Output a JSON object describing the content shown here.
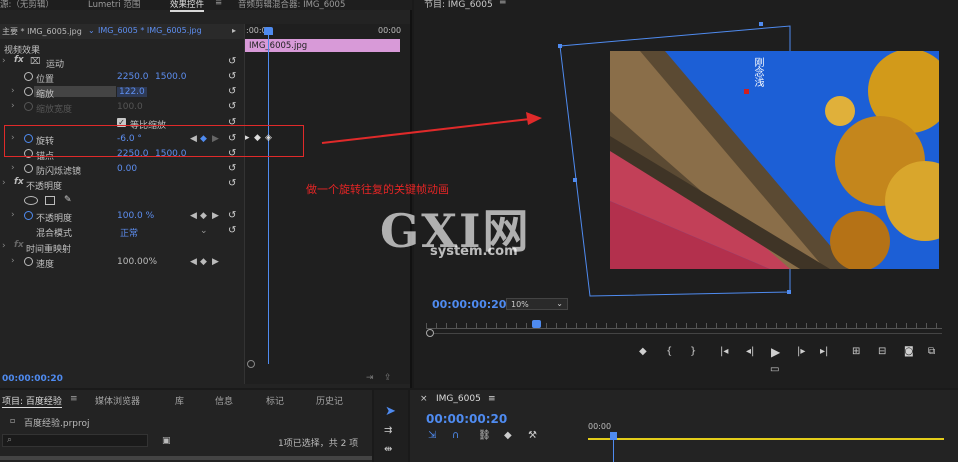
{
  "effect_controls": {
    "tabs": [
      "源:（无剪辑）",
      "Lumetri 范围",
      "效果控件",
      "≡",
      "音频剪辑混合器: IMG_6005"
    ],
    "master_label": "主要 * IMG_6005.jpg",
    "clip_label": "IMG_6005 * IMG_6005.jpg",
    "timeline_start": ":00:00",
    "timeline_end": "00:00",
    "clip_name": "IMG_6005.jpg",
    "section_video": "视频效果",
    "motion": "运动",
    "position_label": "位置",
    "position_x": "2250.0",
    "position_y": "1500.0",
    "scale_label": "缩放",
    "scale_value": "122.0",
    "scale_width_label": "缩放宽度",
    "scale_width_value": "100.0",
    "uniform_scale_label": "等比缩放",
    "rotation_label": "旋转",
    "rotation_value": "-6.0 °",
    "anchor_label": "锚点",
    "anchor_x": "2250.0",
    "anchor_y": "1500.0",
    "antiflicker_label": "防闪烁滤镜",
    "antiflicker_value": "0.00",
    "opacity_section": "不透明度",
    "opacity_label": "不透明度",
    "opacity_value": "100.0 %",
    "blend_label": "混合模式",
    "blend_value": "正常",
    "timeremap_section": "时间重映射",
    "speed_label": "速度",
    "speed_value": "100.00%",
    "timecode": "00:00:00:20"
  },
  "annotation": {
    "text": "做一个旋转往复的关键帧动画",
    "color": "#e52525"
  },
  "program_monitor": {
    "title": "节目: IMG_6005",
    "menu_icon": "≡",
    "timecode": "00:00:00:20",
    "zoom": "10%",
    "image_caption": "刚念浅"
  },
  "watermark": {
    "main": "GXI网",
    "sub": "system.com"
  },
  "project_panel": {
    "tabs": [
      "项目: 百度经验",
      "≡",
      "媒体浏览器",
      "库",
      "信息",
      "标记",
      "历史记"
    ],
    "file": "百度经验.prproj",
    "selection_info": "1项已选择，共 2 项"
  },
  "sequence_panel": {
    "title": "IMG_6005",
    "menu_icon": "≡",
    "timecode": "00:00:00:20",
    "ruler_start": "00:00"
  },
  "colors": {
    "accent": "#4f8bf0",
    "clip": "#d89ad8",
    "highlight": "#e02a2a"
  }
}
